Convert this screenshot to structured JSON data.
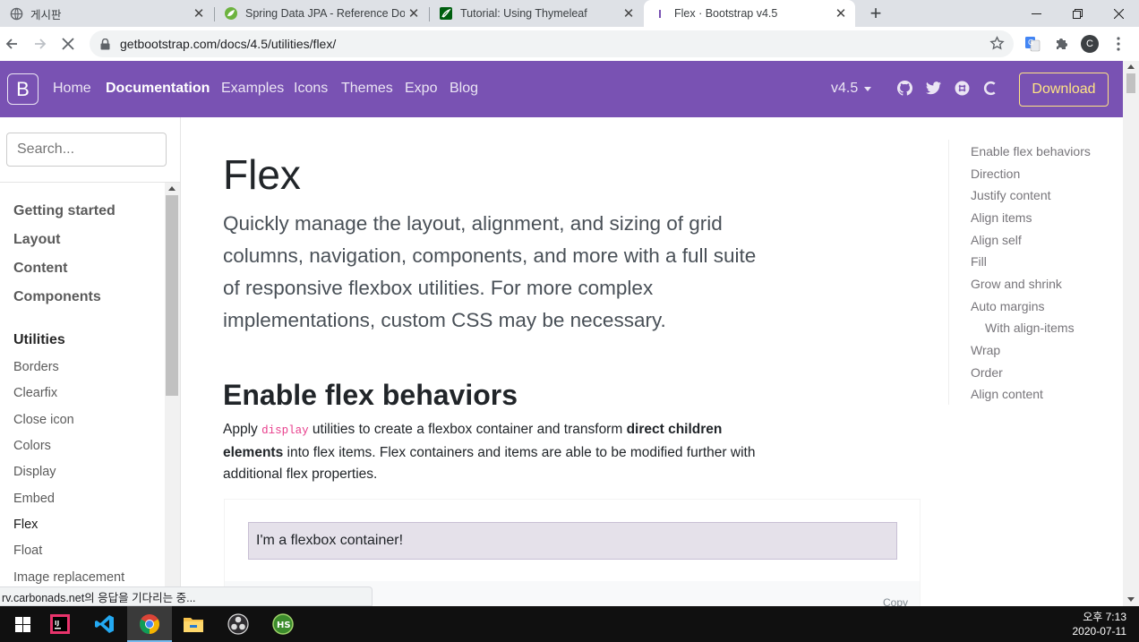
{
  "browser": {
    "tabs": [
      {
        "title": "게시판",
        "icon": "globe-icon"
      },
      {
        "title": "Spring Data JPA - Reference Do",
        "icon": "spring-leaf-icon"
      },
      {
        "title": "Tutorial: Using Thymeleaf",
        "icon": "thymeleaf-icon"
      },
      {
        "title": "Flex · Bootstrap v4.5",
        "icon": "bootstrap-icon"
      }
    ],
    "new_tab_glyph": "+",
    "url": "getbootstrap.com/docs/4.5/utilities/flex/",
    "profile_initial": "C"
  },
  "bootstrap_nav": {
    "logo": "B",
    "links": [
      "Home",
      "Documentation",
      "Examples",
      "Icons",
      "Themes",
      "Expo",
      "Blog"
    ],
    "version": "v4.5",
    "download": "Download",
    "colors": {
      "navbar": "#7952b3",
      "download_accent": "#ffe484"
    }
  },
  "sidebar": {
    "search_placeholder": "Search...",
    "groups": [
      "Getting started",
      "Layout",
      "Content",
      "Components"
    ],
    "active_group": "Utilities",
    "items": [
      "Borders",
      "Clearfix",
      "Close icon",
      "Colors",
      "Display",
      "Embed",
      "Flex",
      "Float",
      "Image replacement"
    ]
  },
  "main": {
    "title": "Flex",
    "lead": "Quickly manage the layout, alignment, and sizing of grid columns, navigation, components, and more with a full suite of responsive flexbox utilities. For more complex implementations, custom CSS may be necessary.",
    "section_title": "Enable flex behaviors",
    "para_1": "Apply ",
    "para_code": "display",
    "para_2": " utilities to create a flexbox container and transform ",
    "para_bold": "direct children elements",
    "para_3": " into flex items. Flex containers and items are able to be modified further with additional flex properties.",
    "example_text": "I'm a flexbox container!",
    "copy_label": "Copy"
  },
  "toc": [
    "Enable flex behaviors",
    "Direction",
    "Justify content",
    "Align items",
    "Align self",
    "Fill",
    "Grow and shrink",
    "Auto margins",
    "With align-items",
    "Wrap",
    "Order",
    "Align content"
  ],
  "status_text": "rv.carbonads.net의 응답을 기다리는 중...",
  "taskbar": {
    "apps": [
      "windows-start-icon",
      "intellij-icon",
      "vscode-icon",
      "chrome-icon",
      "file-explorer-icon",
      "obs-icon",
      "heidisql-icon"
    ],
    "time": "오후 7:13",
    "date": "2020-07-11"
  }
}
